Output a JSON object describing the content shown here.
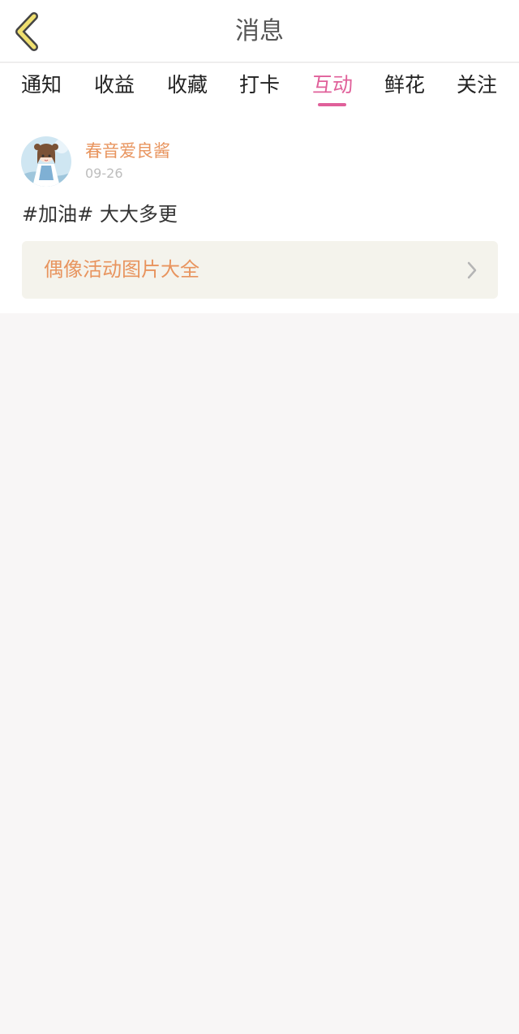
{
  "header": {
    "title": "消息"
  },
  "tabs": [
    {
      "label": "通知"
    },
    {
      "label": "收益"
    },
    {
      "label": "收藏"
    },
    {
      "label": "打卡"
    },
    {
      "label": "互动",
      "active": true
    },
    {
      "label": "鲜花"
    },
    {
      "label": "关注"
    }
  ],
  "message": {
    "username": "春音爱良酱",
    "date": "09-26",
    "text": "#加油# 大大多更",
    "link_title": "偶像活动图片大全"
  },
  "colors": {
    "accent": "#e0609a",
    "username": "#e8945e",
    "back_icon": "#f0e070",
    "background": "#f8f6f6"
  },
  "icons": {
    "back": "chevron-left-icon",
    "card_arrow": "chevron-right-icon"
  }
}
